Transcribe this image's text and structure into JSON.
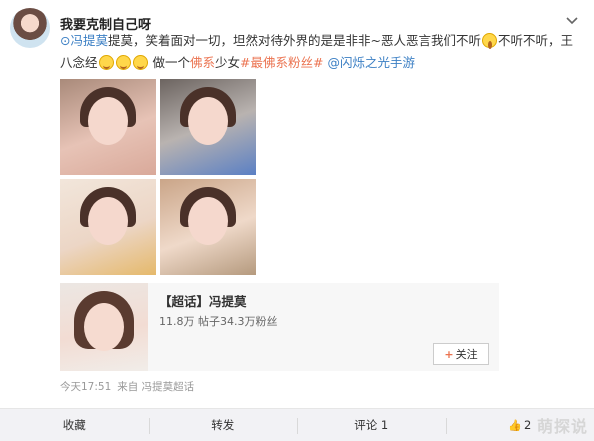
{
  "post": {
    "username": "我要克制自己呀",
    "text": {
      "mention": "冯提莫",
      "part1": "提莫，笑着面对一切，坦然对待外界的是是非非~恶人恶言我们不听",
      "part2": "不听不听，王八念经",
      "part3": "做一个",
      "hashtag1": "佛系",
      "part4": "少女",
      "hashtag2": "#最佛系粉丝#",
      "tag3": "@闪烁之光手游"
    },
    "icons": {
      "more": "chevron-down-icon",
      "emoji_shock": "shocked-emoji-icon",
      "emoji_smile": "grin-emoji-icon"
    }
  },
  "super_topic": {
    "title": "【超话】冯提莫",
    "stats": "11.8万 帖子34.3万粉丝",
    "follow_label": "关注"
  },
  "meta": {
    "time": "今天17:51",
    "source": "来自 冯提莫超话"
  },
  "actions": {
    "favorite": "收藏",
    "repost": "转发",
    "comment": "评论 1",
    "like": "2"
  },
  "watermark": "萌探说",
  "colors": {
    "accent": "#eb7350",
    "link": "#3b7fc4"
  }
}
